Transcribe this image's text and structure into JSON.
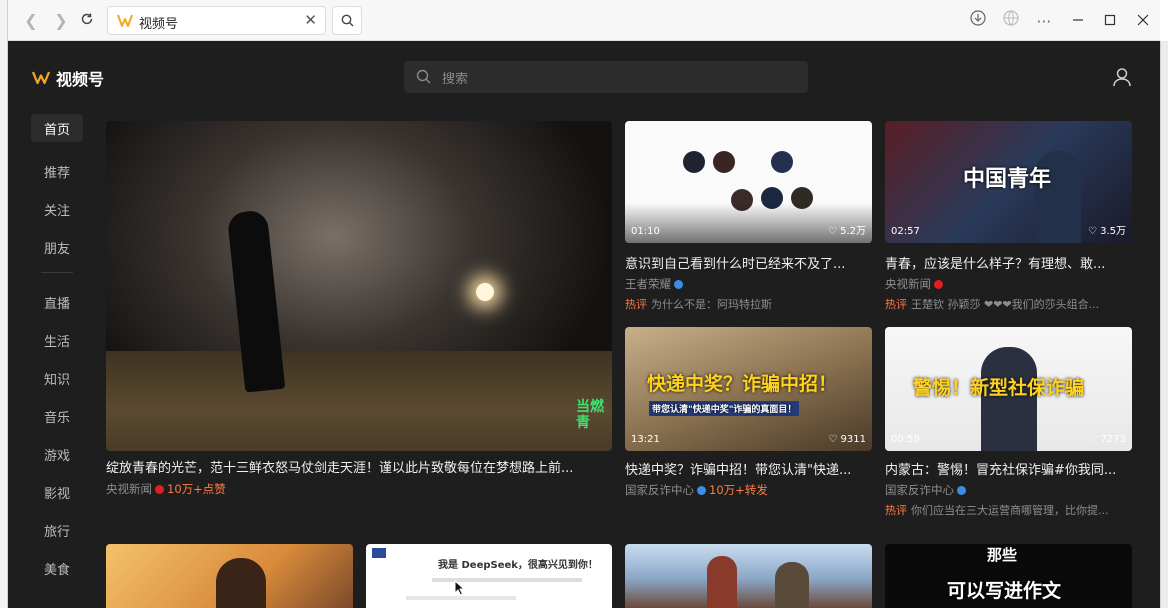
{
  "browser": {
    "tab_title": "视频号",
    "colors": {
      "logo": "#f5a623"
    }
  },
  "app": {
    "logo_text": "视频号",
    "search_placeholder": "搜索",
    "colors": {
      "accent": "#ff7a45",
      "verified_blue": "#3a8ee6",
      "verified_red": "#e02020",
      "bg": "#1e1e1e"
    }
  },
  "sidebar": {
    "items": [
      {
        "label": "首页",
        "active": true
      },
      {
        "label": "推荐"
      },
      {
        "label": "关注"
      },
      {
        "label": "朋友"
      },
      {
        "label": "直播"
      },
      {
        "label": "生活"
      },
      {
        "label": "知识"
      },
      {
        "label": "音乐"
      },
      {
        "label": "游戏"
      },
      {
        "label": "影视"
      },
      {
        "label": "旅行"
      },
      {
        "label": "美食"
      }
    ]
  },
  "featured": {
    "title": "绽放青春的光芒，范十三鲜衣怒马仗剑走天涯！谨以此片致敬每位在梦想路上前...",
    "author": "央视新闻",
    "stat": "10万+点赞",
    "overlay": "当燃 青"
  },
  "cards": [
    {
      "duration": "01:10",
      "likes": "5.2万",
      "title": "意识到自己看到什么时已经来不及了...",
      "author": "王者荣耀",
      "hot_tag": "热评",
      "hot_text": "为什么不是：阿玛特拉斯"
    },
    {
      "duration": "02:57",
      "likes": "3.5万",
      "title": "青春，应该是什么样子？有理想、敢...",
      "author": "央视新闻",
      "hot_tag": "热评",
      "hot_text": "王楚钦 孙颖莎 ❤❤❤我们的莎头组合...",
      "overlay": "中国青年"
    },
    {
      "duration": "13:21",
      "likes": "9311",
      "title": "快递中奖？诈骗中招！带您认清\"快递...",
      "author": "国家反诈中心",
      "stat": "10万+转发",
      "overlay": "快递中奖？诈骗中招！",
      "overlay2": "带您认清\"快递中奖\"诈骗的真面目！"
    },
    {
      "duration": "00:59",
      "likes": "7273",
      "title": "内蒙古：警惕！冒充社保诈骗#你我同...",
      "author": "国家反诈中心",
      "hot_tag": "热评",
      "hot_text": "你们应当在三大运营商哪管理，比你提...",
      "overlay": "警惕！新型社保诈骗"
    }
  ],
  "bottom_row": {
    "card2_text": "我是 DeepSeek，很高兴见到你！",
    "card4_text1": "那些",
    "card4_text2": "可以写进作文"
  }
}
